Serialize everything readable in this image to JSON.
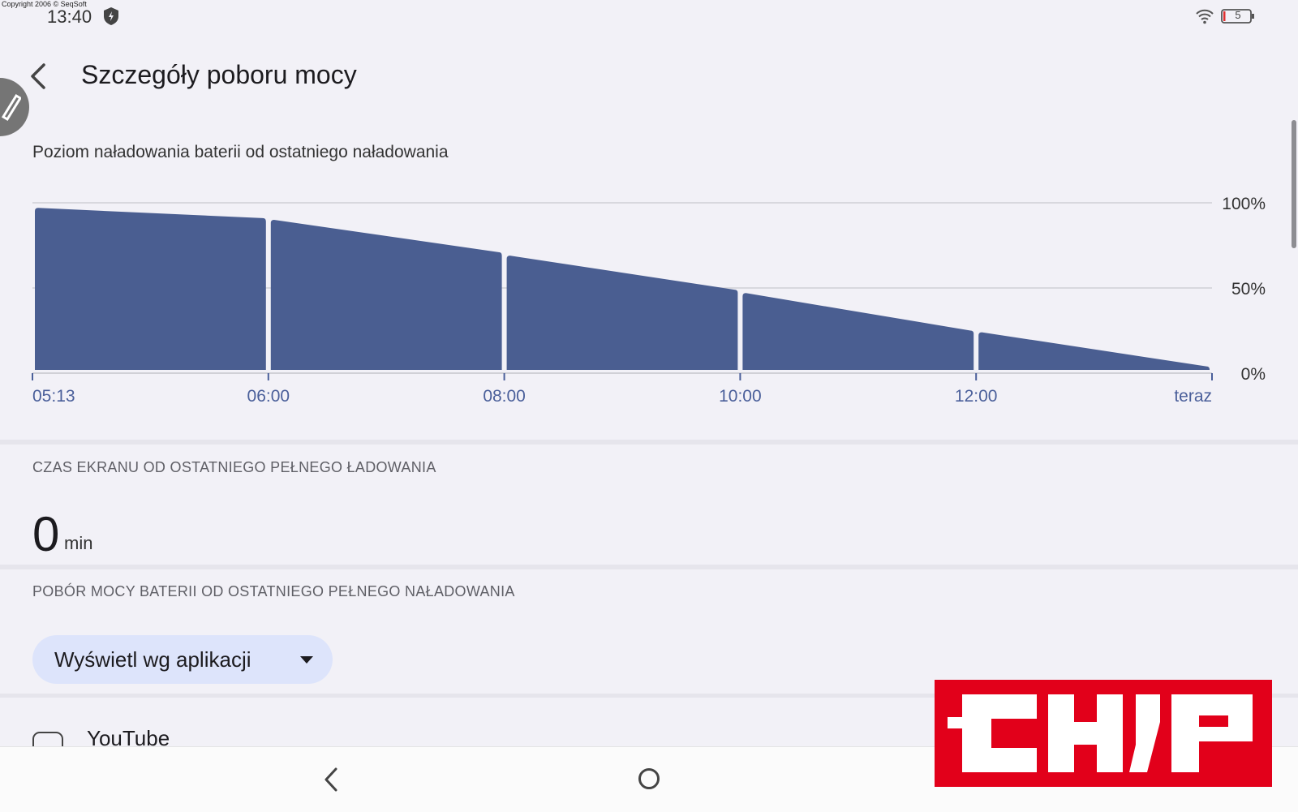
{
  "status_bar": {
    "copyright": "Copyright 2006 © SeqSoft",
    "time": "13:40",
    "battery_level": "5",
    "icons": [
      "shield-icon",
      "wifi-icon",
      "battery-icon"
    ]
  },
  "header": {
    "title": "Szczegóły poboru mocy",
    "back_icon": "back-arrow-icon"
  },
  "battery_chart": {
    "title": "Poziom naładowania baterii od ostatniego naładowania"
  },
  "chart_data": {
    "type": "area",
    "x": [
      "05:13",
      "06:00",
      "08:00",
      "10:00",
      "12:00",
      "teraz"
    ],
    "x_tick_labels": [
      "05:13",
      "06:00",
      "08:00",
      "10:00",
      "12:00",
      "teraz"
    ],
    "segments": [
      {
        "start": [
          0,
          97
        ],
        "end": [
          1,
          91
        ]
      },
      {
        "start": [
          1,
          90
        ],
        "end": [
          2,
          71
        ]
      },
      {
        "start": [
          2,
          69
        ],
        "end": [
          3,
          49
        ]
      },
      {
        "start": [
          3,
          47
        ],
        "end": [
          4,
          25
        ]
      },
      {
        "start": [
          4,
          24
        ],
        "end": [
          5,
          4
        ]
      }
    ],
    "ylim": [
      0,
      100
    ],
    "y_tick_labels": [
      "100%",
      "50%",
      "0%"
    ],
    "grid": true,
    "colors": {
      "fill": "#4a5e91",
      "grid": "#d0d0d6",
      "axis": "#4a5f9a"
    }
  },
  "screen_time": {
    "header": "CZAS EKRANU OD OSTATNIEGO PEŁNEGO ŁADOWANIA",
    "value": "0",
    "unit": "min"
  },
  "usage": {
    "header": "POBÓR MOCY BATERII OD OSTATNIEGO PEŁNEGO NAŁADOWANIA",
    "dropdown_label": "Wyświetl wg aplikacji",
    "apps": [
      {
        "name": "YouTube",
        "icon": "youtube-icon"
      }
    ]
  },
  "navigation": {
    "icons": [
      "nav-back-icon",
      "nav-home-icon"
    ]
  },
  "watermark": {
    "logo_text": "CHIP",
    "color": "#e2001a"
  }
}
